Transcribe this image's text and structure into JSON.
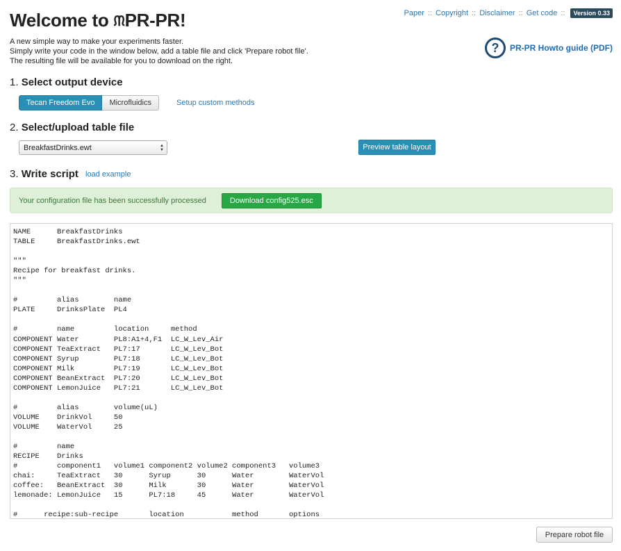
{
  "header": {
    "title_prefix": "Welcome to ",
    "title_suffix": "PR-PR!",
    "intro_lines": [
      "A new simple way to make your experiments faster.",
      "Simply write your code in the window below, add a table file and click 'Prepare robot file'.",
      "The resulting file will be available for you to download on the right."
    ]
  },
  "nav": {
    "links": [
      "Paper",
      "Copyright",
      "Disclaimer",
      "Get code"
    ],
    "separator": "::",
    "version": "Version 0.33"
  },
  "howto": {
    "icon_glyph": "?",
    "label": "PR-PR Howto guide (PDF)"
  },
  "section1": {
    "number": "1.",
    "heading": "Select output device",
    "devices": [
      "Tecan Freedom Evo",
      "Microfluidics"
    ],
    "selected_device": "Tecan Freedom Evo",
    "custom_link": "Setup custom methods"
  },
  "section2": {
    "number": "2.",
    "heading": "Select/upload table file",
    "selected_file": "BreakfastDrinks.ewt",
    "preview_button": "Preview table layout"
  },
  "section3": {
    "number": "3.",
    "heading": "Write script",
    "example_link": "load example"
  },
  "alert": {
    "message": "Your configuration file has been successfully processed",
    "download_button": "Download config525.esc",
    "color": "#dff0d8"
  },
  "script": {
    "lines": [
      "NAME      BreakfastDrinks",
      "TABLE     BreakfastDrinks.ewt",
      "",
      "\"\"\"",
      "Recipe for breakfast drinks.",
      "\"\"\"",
      "",
      "#         alias        name",
      "PLATE     DrinksPlate  PL4",
      "",
      "#         name         location     method",
      "COMPONENT Water        PL8:A1+4,F1  LC_W_Lev_Air",
      "COMPONENT TeaExtract   PL7:17       LC_W_Lev_Bot",
      "COMPONENT Syrup        PL7:18       LC_W_Lev_Bot",
      "COMPONENT Milk         PL7:19       LC_W_Lev_Bot",
      "COMPONENT BeanExtract  PL7:20       LC_W_Lev_Bot",
      "COMPONENT LemonJuice   PL7:21       LC_W_Lev_Bot",
      "",
      "#         alias        volume(uL)",
      "VOLUME    DrinkVol     50",
      "VOLUME    WaterVol     25",
      "",
      "#         name",
      "RECIPE    Drinks",
      "#         component1   volume1 component2 volume2 component3   volume3",
      "chai:     TeaExtract   30      Syrup      30      Water        WaterVol",
      "coffee:   BeanExtract  30      Milk       30      Water        WaterVol",
      "lemonade: LemonJuice   15      PL7:18     45      Water        WaterVol",
      "",
      "#      recipe:sub-recipe       location           method       options"
    ]
  },
  "footer": {
    "prepare_button": "Prepare robot file"
  }
}
